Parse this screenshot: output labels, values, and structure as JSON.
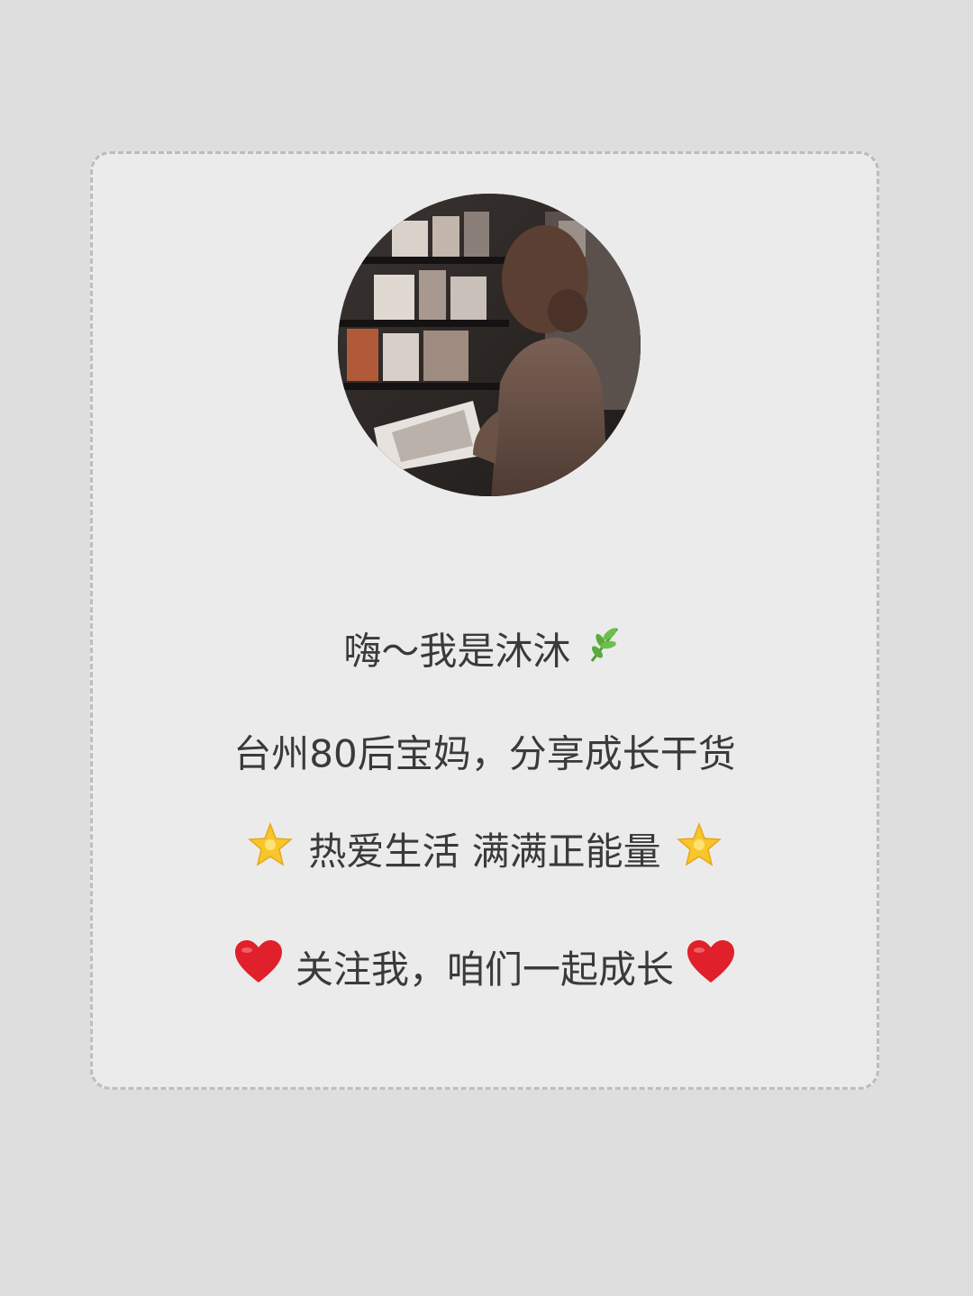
{
  "profile": {
    "avatar_alt": "avatar",
    "greeting": "嗨～我是沐沐",
    "intro": "台州80后宝妈，分享成长干货",
    "motto": "热爱生活 满满正能量",
    "follow": "关注我，咱们一起成长"
  },
  "icons": {
    "greeting_icon": "herb-icon",
    "motto_icons": "star-icon",
    "follow_icons": "heart-icon"
  },
  "colors": {
    "background": "#dedede",
    "card": "#ebebeb",
    "border": "#bdbdbd",
    "text": "#3a3a3a",
    "heart": "#e0202a",
    "star": "#f7c62b",
    "herb": "#4f9a3a"
  }
}
